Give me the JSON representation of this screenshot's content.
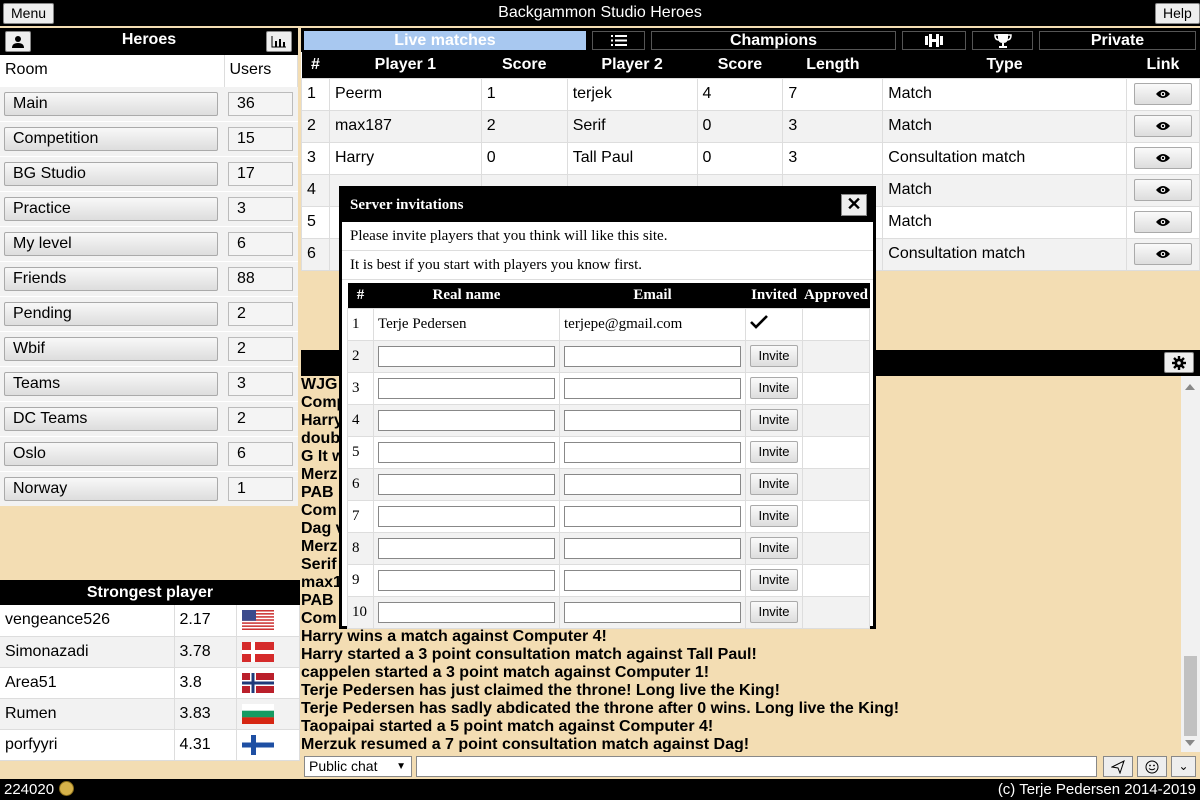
{
  "app": {
    "title": "Backgammon Studio Heroes",
    "menu_label": "Menu",
    "help_label": "Help"
  },
  "heroes": {
    "title": "Heroes",
    "col_room": "Room",
    "col_users": "Users",
    "rooms": [
      {
        "name": "Main",
        "users": "36"
      },
      {
        "name": "Competition",
        "users": "15"
      },
      {
        "name": "BG Studio",
        "users": "17"
      },
      {
        "name": "Practice",
        "users": "3"
      },
      {
        "name": "My level",
        "users": "6"
      },
      {
        "name": "Friends",
        "users": "88"
      },
      {
        "name": "Pending",
        "users": "2"
      },
      {
        "name": "Wbif",
        "users": "2"
      },
      {
        "name": "Teams",
        "users": "3"
      },
      {
        "name": "DC Teams",
        "users": "2"
      },
      {
        "name": "Oslo",
        "users": "6"
      },
      {
        "name": "Norway",
        "users": "1"
      }
    ]
  },
  "strongest": {
    "title": "Strongest player",
    "players": [
      {
        "name": "vengeance526",
        "rating": "2.17",
        "flag": "us"
      },
      {
        "name": "Simonazadi",
        "rating": "3.78",
        "flag": "dk"
      },
      {
        "name": "Area51",
        "rating": "3.8",
        "flag": "no"
      },
      {
        "name": "Rumen",
        "rating": "3.83",
        "flag": "bg"
      },
      {
        "name": "porfyyri",
        "rating": "4.31",
        "flag": "fi"
      }
    ]
  },
  "tabs": {
    "live": "Live matches",
    "champions": "Champions",
    "private": "Private",
    "accent": "#a8c8f0"
  },
  "matches": {
    "headers": [
      "#",
      "Player 1",
      "Score",
      "Player 2",
      "Score",
      "Length",
      "Type",
      "Link"
    ],
    "rows": [
      {
        "n": "1",
        "p1": "Peerm",
        "s1": "1",
        "p2": "terjek",
        "s2": "4",
        "len": "7",
        "type": "Match"
      },
      {
        "n": "2",
        "p1": "max187",
        "s1": "2",
        "p2": "Serif",
        "s2": "0",
        "len": "3",
        "type": "Match"
      },
      {
        "n": "3",
        "p1": "Harry",
        "s1": "0",
        "p2": "Tall Paul",
        "s2": "0",
        "len": "3",
        "type": "Consultation match"
      },
      {
        "n": "4",
        "p1": "",
        "s1": "",
        "p2": "",
        "s2": "",
        "len": "",
        "type": "Match"
      },
      {
        "n": "5",
        "p1": "",
        "s1": "",
        "p2": "",
        "s2": "",
        "len": "",
        "type": "Match"
      },
      {
        "n": "6",
        "p1": "",
        "s1": "",
        "p2": "",
        "s2": "",
        "len": "",
        "type": "Consultation match"
      }
    ]
  },
  "chat": {
    "lines": [
      "WJG",
      "Comp",
      "Harry",
      "doub",
      "G It w",
      "Merz",
      "PAB",
      "Com",
      "Dag v",
      "Merz",
      "Serif",
      "max1",
      "PAB",
      "Com",
      "Harry wins a match against Computer 4!",
      "Harry started a 3 point consultation match against Tall Paul!",
      "cappelen started a 3 point match against Computer 1!",
      "Terje Pedersen has just claimed the throne! Long live the King!",
      "Terje Pedersen has sadly abdicated the throne after 0 wins. Long live the King!",
      "Taopaipai started a 5 point match against Computer 4!",
      "Merzuk resumed a 7 point consultation match against Dag!"
    ],
    "channel": "Public chat"
  },
  "footer": {
    "count": "224020",
    "copyright": "(c) Terje Pedersen 2014-2019"
  },
  "modal": {
    "title": "Server invitations",
    "line1": "Please invite players that you think will like this site.",
    "line2": "It is best if you start with players you know first.",
    "headers": [
      "#",
      "Real name",
      "Email",
      "Invited",
      "Approved"
    ],
    "first": {
      "n": "1",
      "name": "Terje Pedersen",
      "email": "terjepe@gmail.com"
    },
    "invite_label": "Invite",
    "rows": [
      "2",
      "3",
      "4",
      "5",
      "6",
      "7",
      "8",
      "9",
      "10"
    ]
  }
}
